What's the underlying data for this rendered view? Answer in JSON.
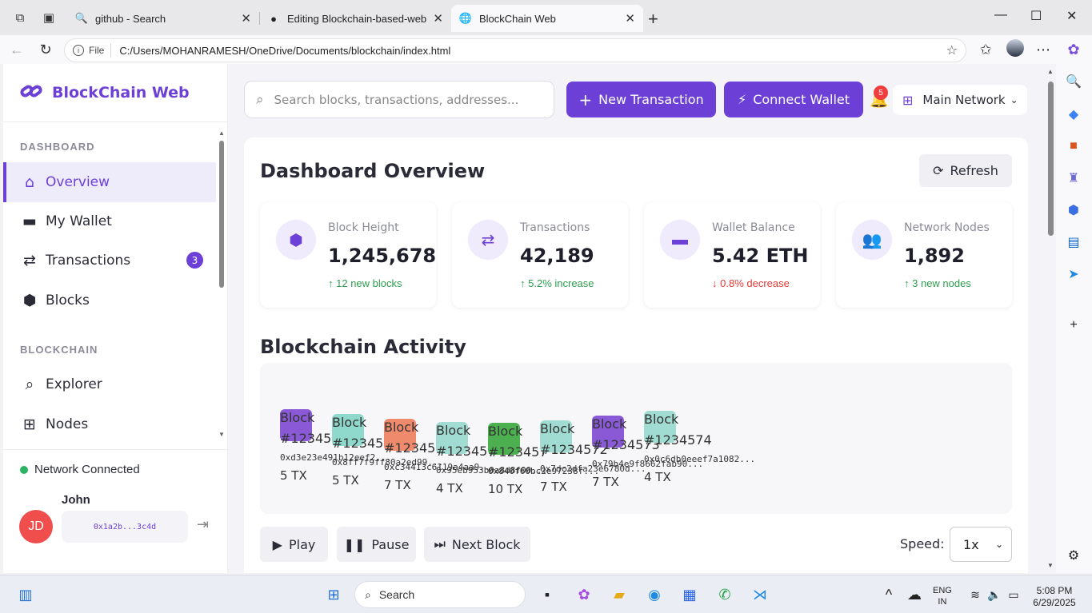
{
  "browser": {
    "tabs": [
      {
        "title": "github - Search",
        "icon": "search-icon"
      },
      {
        "title": "Editing Blockchain-based-web-ap",
        "icon": "github-icon"
      },
      {
        "title": "BlockChain Web",
        "icon": "globe-icon"
      }
    ],
    "url_scheme": "File",
    "url": "C:/Users/MOHANRAMESH/OneDrive/Documents/blockchain/index.html"
  },
  "app": {
    "brand": "BlockChain Web",
    "accent": "#6c3fd6",
    "sidebar": {
      "sections": [
        {
          "title": "DASHBOARD",
          "items": [
            {
              "label": "Overview",
              "icon": "home-icon",
              "active": true
            },
            {
              "label": "My Wallet",
              "icon": "wallet-icon"
            },
            {
              "label": "Transactions",
              "icon": "exchange-icon",
              "badge": "3"
            },
            {
              "label": "Blocks",
              "icon": "cubes-icon"
            }
          ]
        },
        {
          "title": "BLOCKCHAIN",
          "items": [
            {
              "label": "Explorer",
              "icon": "search-icon"
            },
            {
              "label": "Nodes",
              "icon": "network-icon"
            }
          ]
        }
      ],
      "network_status": "Network Connected",
      "user": {
        "initials": "JD",
        "name": "John",
        "address": "0x1a2b...3c4d"
      }
    },
    "header": {
      "search_placeholder": "Search blocks, transactions, addresses...",
      "new_transaction": "New Transaction",
      "connect_wallet": "Connect Wallet",
      "notifications": "5",
      "network": "Main Network"
    },
    "dashboard": {
      "title": "Dashboard Overview",
      "refresh": "Refresh",
      "stats": [
        {
          "label": "Block Height",
          "value": "1,245,678",
          "change": "12 new blocks",
          "trend": "up",
          "icon": "cube-icon"
        },
        {
          "label": "Transactions",
          "value": "42,189",
          "change": "5.2% increase",
          "trend": "up",
          "icon": "exchange-icon"
        },
        {
          "label": "Wallet Balance",
          "value": "5.42 ETH",
          "change": "0.8% decrease",
          "trend": "down",
          "icon": "wallet-icon"
        },
        {
          "label": "Network Nodes",
          "value": "1,892",
          "change": "3 new nodes",
          "trend": "up",
          "icon": "users-icon"
        }
      ],
      "activity_title": "Blockchain Activity",
      "blocks": [
        {
          "label": "Block #123456",
          "hash": "0xd3e23e491b12eef2...",
          "tx": "5 TX",
          "color": "#8a5ad6"
        },
        {
          "label": "Block #123456",
          "hash": "0x8ff7f9ff80a2ed99...",
          "tx": "5 TX",
          "color": "#8fd8cc"
        },
        {
          "label": "Block #123456",
          "hash": "0xc34413c6119a4aa9...",
          "tx": "7 TX",
          "color": "#f08a6c"
        },
        {
          "label": "Block #123457",
          "hash": "0x95eb953b0a8d8f00...",
          "tx": "4 TX",
          "color": "#a0dcd2"
        },
        {
          "label": "Block #123457",
          "hash": "0x840f60bc2e97238f...",
          "tx": "10 TX",
          "color": "#4caf50"
        },
        {
          "label": "Block #1234572",
          "hash": "0x7dc2dfa23e6780d...",
          "tx": "7 TX",
          "color": "#a0dcd2"
        },
        {
          "label": "Block #1234573",
          "hash": "0x79b4e9f8662fab90...",
          "tx": "7 TX",
          "color": "#8a5ad6"
        },
        {
          "label": "Block #1234574",
          "hash": "0x0c6db0eeef7a1082...",
          "tx": "4 TX",
          "color": "#a0dcd2"
        }
      ],
      "controls": {
        "play": "Play",
        "pause": "Pause",
        "next": "Next Block",
        "speed_label": "Speed:",
        "speed": "1x"
      }
    }
  },
  "taskbar": {
    "search": "Search",
    "lang1": "ENG",
    "lang2": "IN",
    "time": "5:08 PM",
    "date": "6/29/2025"
  }
}
